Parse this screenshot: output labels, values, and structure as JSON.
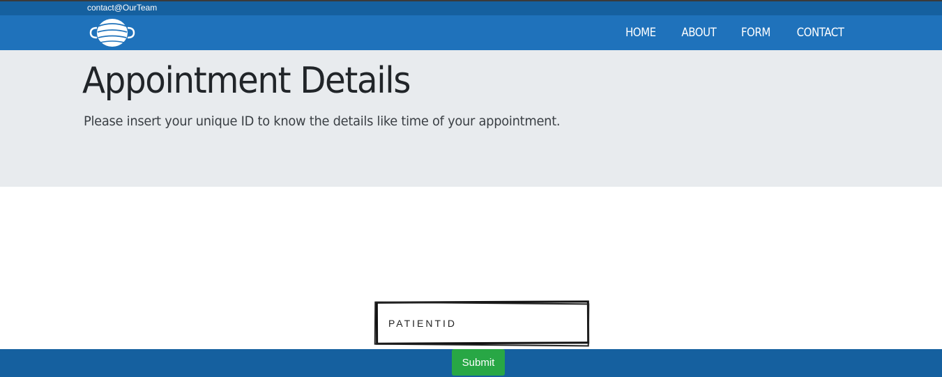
{
  "topbar": {
    "email": "contact@OurTeam"
  },
  "logo": {
    "icon": "face-mask-icon"
  },
  "nav": {
    "items": [
      "HOME",
      "ABOUT",
      "FORM",
      "CONTACT"
    ]
  },
  "hero": {
    "title": "Appointment Details",
    "subtitle": "Please insert your unique ID to know the details like time of your appointment."
  },
  "form": {
    "patient_id_placeholder": "PATIENTID",
    "patient_id_value": "",
    "submit_label": "Submit"
  },
  "colors": {
    "topbar": "#15609f",
    "navbar": "#1f72bb",
    "hero_bg": "#e8ebee",
    "footer": "#15609f",
    "submit": "#28a745"
  }
}
